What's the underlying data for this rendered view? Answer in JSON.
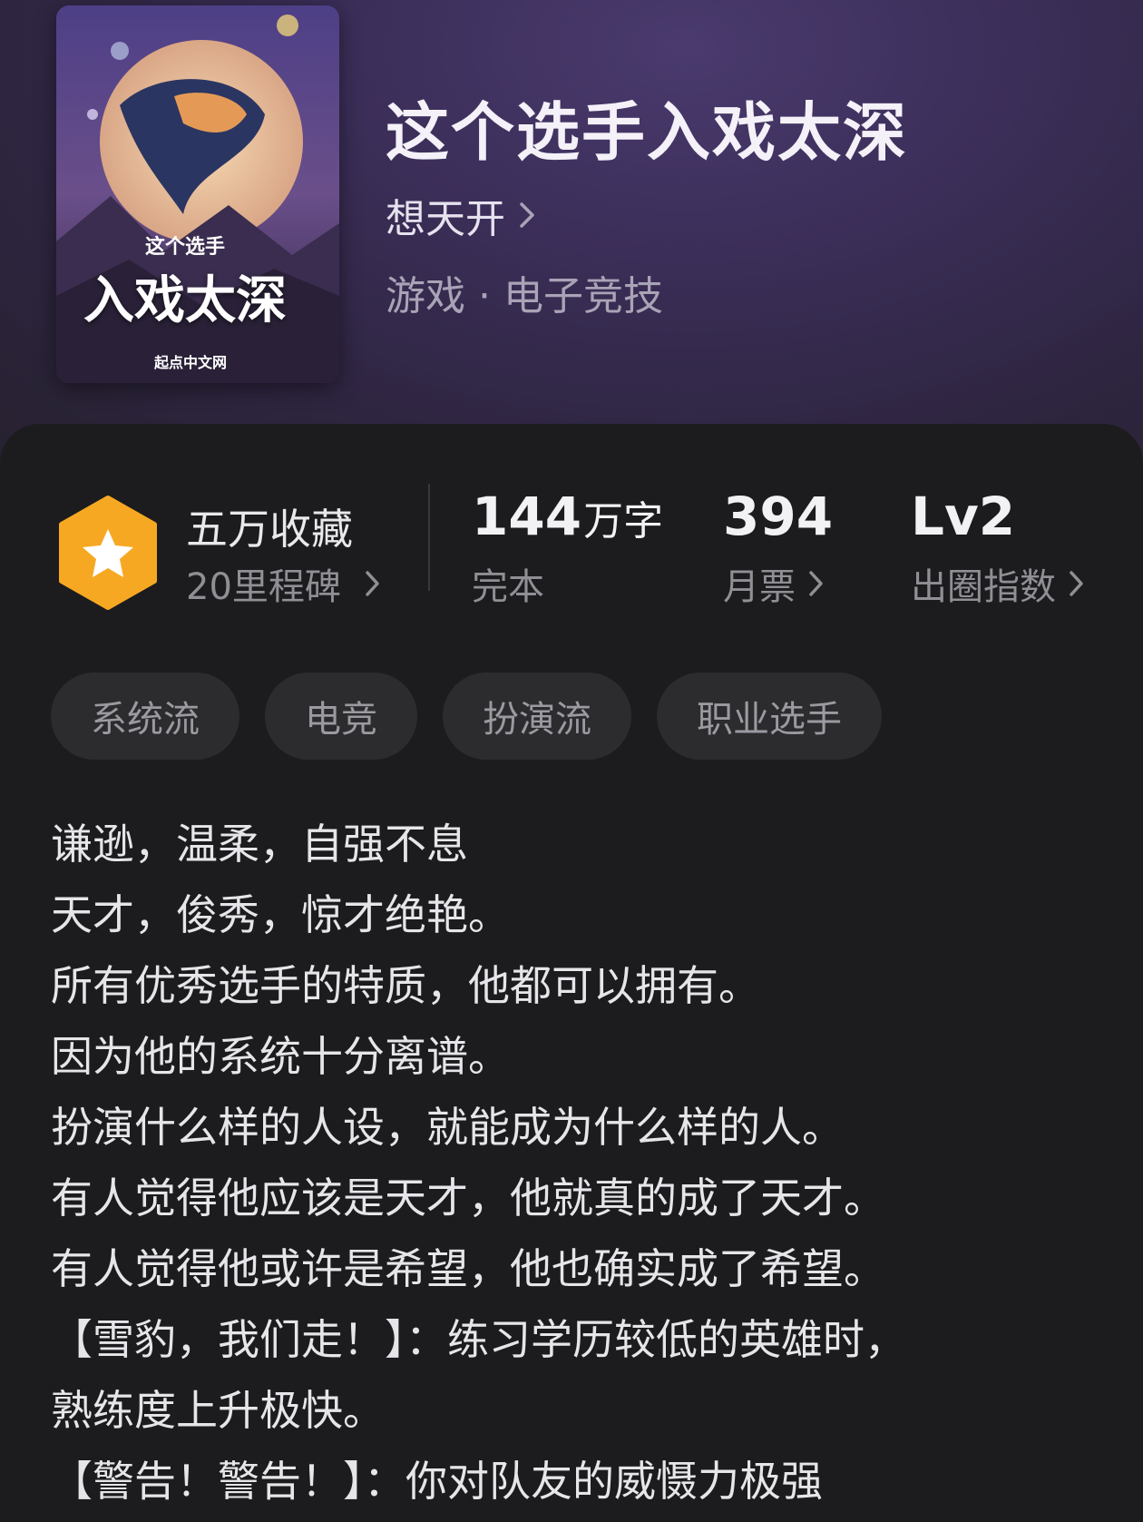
{
  "book": {
    "title": "这个选手入戏太深",
    "author": "想天开",
    "category": "游戏 · 电子竞技",
    "cover": {
      "small_title": "这个选手",
      "big_title": "入戏太深",
      "publisher": "起点中文网"
    }
  },
  "stats": {
    "collection_title": "五万收藏",
    "collection_sub": "20里程碑",
    "word_count": "144",
    "word_unit": "万字",
    "status": "完本",
    "monthly_votes": "394",
    "monthly_votes_label": "月票",
    "level": "Lv2",
    "level_label": "出圈指数"
  },
  "tags": [
    "系统流",
    "电竞",
    "扮演流",
    "职业选手"
  ],
  "synopsis": [
    "谦逊，温柔，自强不息",
    "天才，俊秀，惊才绝艳。",
    "所有优秀选手的特质，他都可以拥有。",
    "因为他的系统十分离谱。",
    "扮演什么样的人设，就能成为什么样的人。",
    "有人觉得他应该是天才，他就真的成了天才。",
    "有人觉得他或许是希望，他也确实成了希望。",
    "【雪豹，我们走！】：练习学历较低的英雄时，",
    "熟练度上升极快。",
    "【警告！警告！】：你对队友的威慑力极强"
  ],
  "colors": {
    "badge": "#f7a823",
    "hero_bg": "#3b2e58",
    "panel_bg": "#1c1c1e"
  }
}
